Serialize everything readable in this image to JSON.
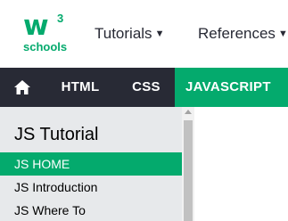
{
  "brand": {
    "mark": "w",
    "superscript": "3",
    "name": "schools",
    "color": "#04AA6D"
  },
  "top_menu": [
    {
      "label": "Tutorials"
    },
    {
      "label": "References"
    }
  ],
  "nav": {
    "home_icon": "home-icon",
    "items": [
      {
        "label": "HTML"
      },
      {
        "label": "CSS"
      },
      {
        "label": "JAVASCRIPT",
        "active": true
      }
    ],
    "colors": {
      "background": "#282A35",
      "active": "#04AA6D"
    }
  },
  "sidebar": {
    "title": "JS Tutorial",
    "items": [
      {
        "label": "JS HOME",
        "active": true
      },
      {
        "label": "JS Introduction"
      },
      {
        "label": "JS Where To"
      }
    ]
  }
}
